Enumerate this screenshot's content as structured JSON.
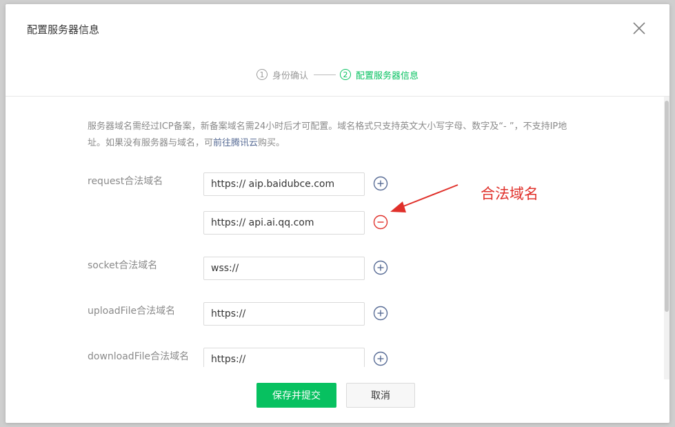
{
  "dialog": {
    "title": "配置服务器信息"
  },
  "steps": [
    {
      "num": "1",
      "label": "身份确认"
    },
    {
      "num": "2",
      "label": "配置服务器信息"
    }
  ],
  "notice": {
    "text_before": "服务器域名需经过ICP备案，新备案域名需24小时后才可配置。域名格式只支持英文大小写字母、数字及“- ”，不支持IP地址。如果没有服务器与域名，可",
    "link_text": "前往腾讯云",
    "text_after": "购买。"
  },
  "domains": {
    "request": {
      "label": "request合法域名",
      "values": [
        "https:// aip.baidubce.com",
        "https:// api.ai.qq.com"
      ]
    },
    "socket": {
      "label": "socket合法域名",
      "value": "wss://"
    },
    "uploadFile": {
      "label": "uploadFile合法域名",
      "value": "https://"
    },
    "downloadFile": {
      "label": "downloadFile合法域名",
      "value": "https://"
    }
  },
  "annotation": {
    "text": "合法域名",
    "color": "#e0302a"
  },
  "footer": {
    "submit_label": "保存并提交",
    "cancel_label": "取消"
  },
  "colors": {
    "accent": "#07c160",
    "icon": "#576b95",
    "danger": "#e0302a"
  }
}
